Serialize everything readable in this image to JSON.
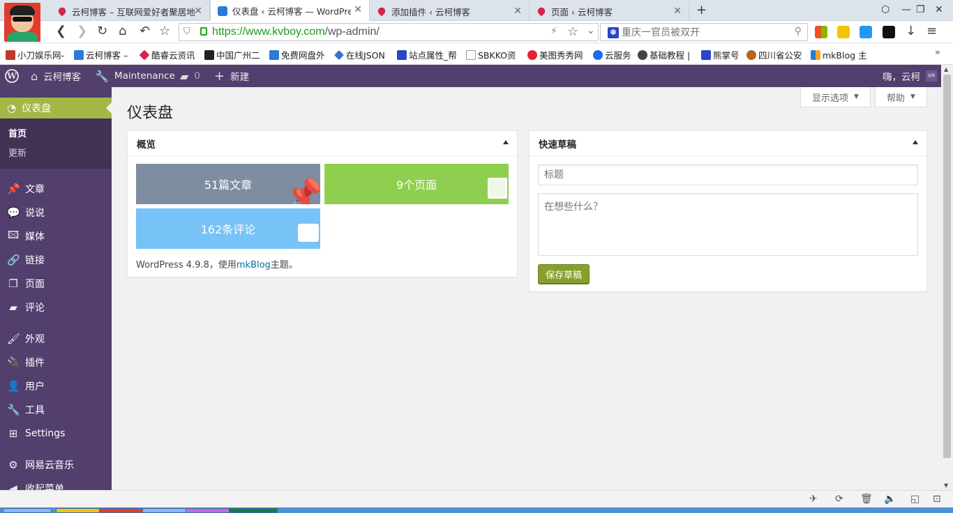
{
  "browser": {
    "tabs": [
      {
        "title": "云柯博客 – 互联网爱好者聚居地",
        "active": false
      },
      {
        "title": "仪表盘 ‹ 云柯博客 — WordPress",
        "active": true
      },
      {
        "title": "添加插件 ‹ 云柯博客",
        "active": false
      },
      {
        "title": "页面 ‹ 云柯博客",
        "active": false
      }
    ],
    "url_host": "https://www.kvboy.com",
    "url_path": "/wp-admin/",
    "search_placeholder": "重庆一官员被双开",
    "bookmarks": [
      "小刀娱乐网-",
      "云柯博客 –",
      "酷睿云资讯",
      "中国广州二",
      "免费网盘外",
      "在线JSON",
      "站点属性_帮",
      "SBKKO资",
      "美图秀秀网",
      "云服务",
      "基础教程 |",
      "熊掌号",
      "四川省公安",
      "mkBlog 主"
    ],
    "more_bookmarks": "»"
  },
  "adminbar": {
    "site_name": "云柯博客",
    "maintenance": "Maintenance",
    "comments_count": "0",
    "new_label": "新建",
    "greeting": "嗨，云柯",
    "avatar_text": "云柯"
  },
  "sidebar": {
    "dashboard": "仪表盘",
    "submenu": [
      "首页",
      "更新"
    ],
    "items": [
      {
        "label": "文章",
        "icon": "pushpin-icon"
      },
      {
        "label": "说说",
        "icon": "speech-bubbles-icon"
      },
      {
        "label": "媒体",
        "icon": "media-icon"
      },
      {
        "label": "链接",
        "icon": "link-icon"
      },
      {
        "label": "页面",
        "icon": "page-icon"
      },
      {
        "label": "评论",
        "icon": "comment-icon"
      },
      {
        "label": "外观",
        "icon": "paintbrush-icon"
      },
      {
        "label": "插件",
        "icon": "plugin-icon"
      },
      {
        "label": "用户",
        "icon": "user-icon"
      },
      {
        "label": "工具",
        "icon": "wrench-icon"
      },
      {
        "label": "Settings",
        "icon": "settings-icon"
      },
      {
        "label": "网易云音乐",
        "icon": "gear-icon"
      },
      {
        "label": "收起菜单",
        "icon": "collapse-icon"
      }
    ]
  },
  "screen_options": "显示选项",
  "help": "帮助",
  "page_title": "仪表盘",
  "overview": {
    "title": "概览",
    "posts": "51篇文章",
    "pages": "9个页面",
    "comments": "162条评论",
    "footer_prefix": "WordPress 4.9.8，使用",
    "theme_link": "mkBlog",
    "footer_suffix": "主题。",
    "colors": {
      "posts": "#7f8da0",
      "pages": "#8ecf4f",
      "comments": "#77c2f7"
    }
  },
  "quick_draft": {
    "title": "快速草稿",
    "title_placeholder": "标题",
    "content_placeholder": "在想些什么？",
    "save_label": "保存草稿"
  },
  "colors": {
    "adminbar": "#523f6d",
    "sidebar": "#523f6d",
    "active_menu": "#a3b745",
    "save_button": "#87a02c"
  }
}
